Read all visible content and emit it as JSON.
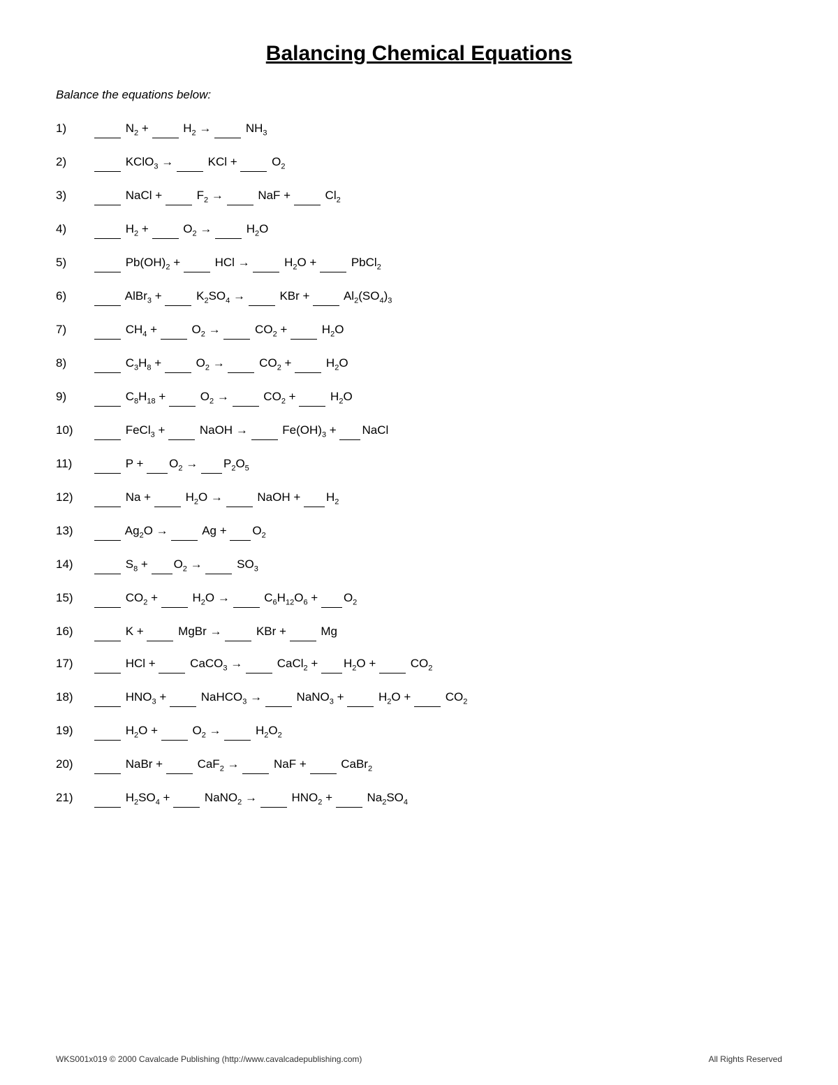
{
  "page": {
    "title": "Balancing Chemical Equations",
    "subtitle": "Balance the equations below:",
    "footer_left": "WKS001x019  © 2000 Cavalcade Publishing (http://www.cavalcadepublishing.com)",
    "footer_right": "All Rights Reserved"
  }
}
